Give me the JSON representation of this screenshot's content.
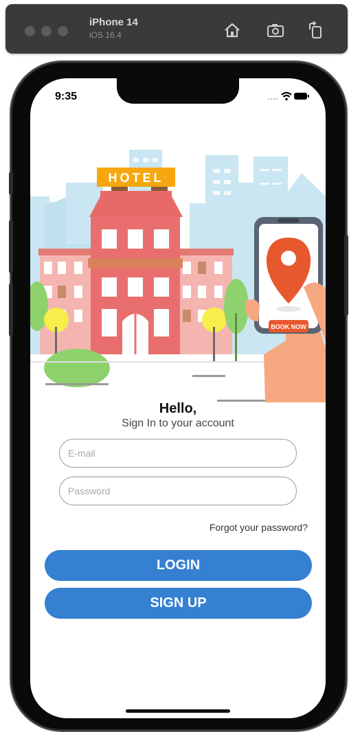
{
  "simulator": {
    "device_name": "iPhone 14",
    "os_version": "iOS 16.4",
    "icons": [
      "home-icon",
      "screenshot-icon",
      "rotate-icon"
    ]
  },
  "status_bar": {
    "time": "9:35",
    "icons": [
      "signal-icon",
      "wifi-icon",
      "battery-icon"
    ]
  },
  "illustration": {
    "hotel_sign": "HOTEL",
    "phone_button": "BOOK NOW"
  },
  "login": {
    "greeting": "Hello,",
    "subtitle": "Sign In to your account",
    "email_placeholder": "E-mail",
    "password_placeholder": "Password",
    "forgot_password": "Forgot your password?",
    "login_button": "LOGIN",
    "signup_button": "SIGN UP"
  },
  "colors": {
    "primary_button": "#3580d1",
    "hotel_building": "#e96f6f",
    "sky_buildings": "#c9e6f2",
    "sign": "#f6a70f",
    "pin": "#e8582f"
  }
}
